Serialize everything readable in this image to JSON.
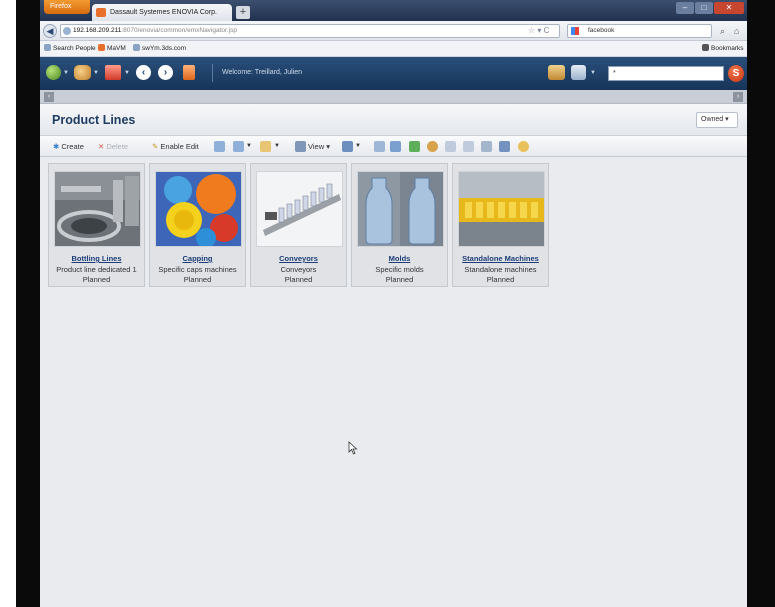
{
  "browser": {
    "menu_button": "Firefox",
    "tab_title": "Dassault Systemes ENOVIA Corp.",
    "new_tab": "+",
    "url_host": "192.168.209.211",
    "url_rest": ":8070/enovia/common/emxNavigator.jsp",
    "search_engine_text": "facebook",
    "bookmarks_label": "Bookmarks",
    "bookmarks": [
      "Search People",
      "MaVM",
      "swYm.3ds.com"
    ]
  },
  "app": {
    "welcome": "Welcome: Treillard, Julien",
    "search_value": "*",
    "search_brand": "S",
    "page_title": "Product Lines",
    "filter_value": "Owned",
    "toolbar": {
      "create": "Create",
      "delete": "Delete",
      "enable_edit": "Enable Edit",
      "view": "View"
    }
  },
  "tiles": [
    {
      "name": "Bottling Lines",
      "description": "Product line dedicated 1",
      "state": "Planned"
    },
    {
      "name": "Capping",
      "description": "Specific caps machines",
      "state": "Planned"
    },
    {
      "name": "Conveyors",
      "description": "Conveyors",
      "state": "Planned"
    },
    {
      "name": "Molds",
      "description": "Specific molds",
      "state": "Planned"
    },
    {
      "name": "Standalone Machines",
      "description": "Standalone machines",
      "state": "Planned"
    }
  ],
  "colors": {
    "app_header": "#1f416b",
    "title_blue": "#1f3d63",
    "link_blue": "#1c3d78"
  }
}
